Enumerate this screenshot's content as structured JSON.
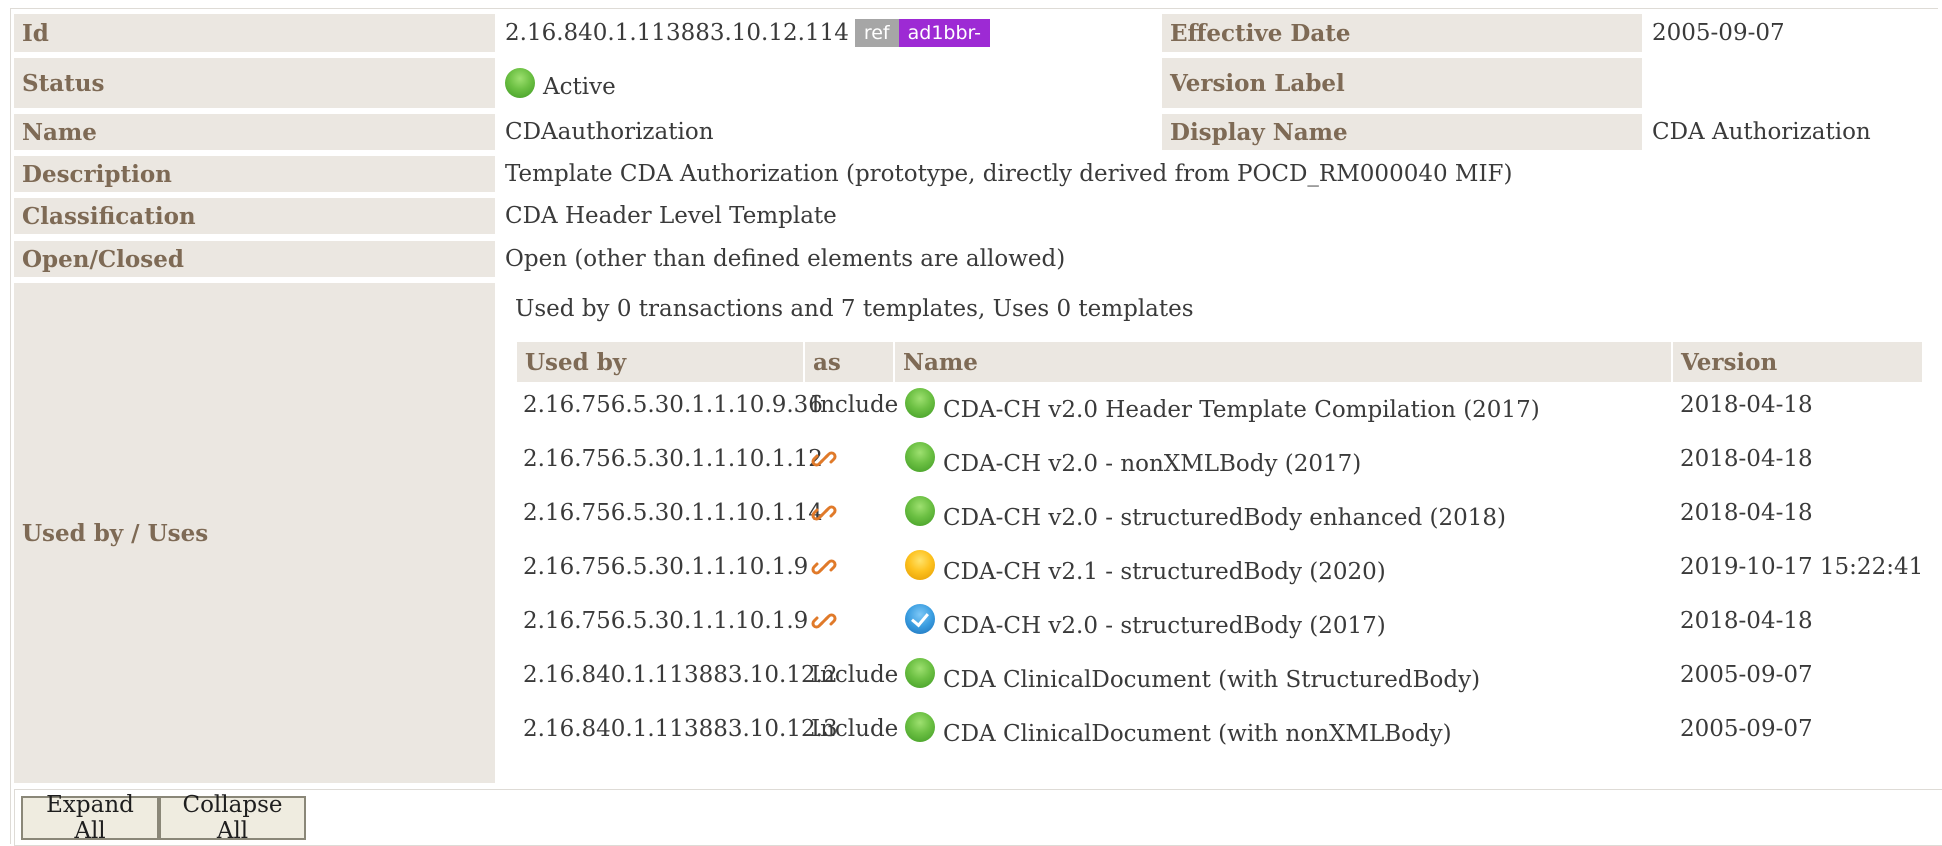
{
  "rows": {
    "id": {
      "label": "Id",
      "value": "2.16.840.1.113883.10.12.114",
      "badge_ref": "ref",
      "badge_prefix": "ad1bbr-"
    },
    "effective_date": {
      "label": "Effective Date",
      "value": "2005-09-07"
    },
    "status": {
      "label": "Status",
      "value": "Active",
      "icon": "status-active-icon"
    },
    "version_label": {
      "label": "Version Label",
      "value": ""
    },
    "name": {
      "label": "Name",
      "value": "CDAauthorization"
    },
    "display_name": {
      "label": "Display Name",
      "value": "CDA Authorization"
    },
    "description": {
      "label": "Description",
      "value": "Template CDA Authorization (prototype, directly derived from POCD_RM000040 MIF)"
    },
    "classification": {
      "label": "Classification",
      "value": "CDA Header Level Template"
    },
    "open_closed": {
      "label": "Open/Closed",
      "value": "Open (other than defined elements are allowed)"
    },
    "used_by_uses": {
      "label": "Used by / Uses"
    }
  },
  "usage": {
    "summary": "Used by 0 transactions and 7 templates, Uses 0 templates",
    "headers": {
      "used_by": "Used by",
      "as": "as",
      "name": "Name",
      "version": "Version"
    },
    "items": [
      {
        "id": "2.16.756.5.30.1.1.10.9.36",
        "as": "Include",
        "status": "green",
        "name": "CDA-CH v2.0 Header Template Compilation (2017)",
        "version": "2018-04-18"
      },
      {
        "id": "2.16.756.5.30.1.1.10.1.12",
        "as": "link-icon",
        "status": "green",
        "name": "CDA-CH v2.0 - nonXMLBody (2017)",
        "version": "2018-04-18"
      },
      {
        "id": "2.16.756.5.30.1.1.10.1.14",
        "as": "link-icon",
        "status": "green",
        "name": "CDA-CH v2.0 - structuredBody enhanced (2018)",
        "version": "2018-04-18"
      },
      {
        "id": "2.16.756.5.30.1.1.10.1.9",
        "as": "link-icon",
        "status": "yellow",
        "name": "CDA-CH v2.1 - structuredBody (2020)",
        "version": "2019-10-17 15:22:41"
      },
      {
        "id": "2.16.756.5.30.1.1.10.1.9",
        "as": "link-icon",
        "status": "blue",
        "name": "CDA-CH v2.0 - structuredBody (2017)",
        "version": "2018-04-18"
      },
      {
        "id": "2.16.840.1.113883.10.12.2",
        "as": "Include",
        "status": "green",
        "name": "CDA ClinicalDocument (with StructuredBody)",
        "version": "2005-09-07"
      },
      {
        "id": "2.16.840.1.113883.10.12.3",
        "as": "Include",
        "status": "green",
        "name": "CDA ClinicalDocument (with nonXMLBody)",
        "version": "2005-09-07"
      }
    ]
  },
  "buttons": {
    "expand_all": "Expand All",
    "collapse_all": "Collapse All"
  },
  "colors": {
    "label_bg": "#ebe7e1",
    "label_text": "#7e6a55",
    "ref_badge": "#a6a6a6",
    "prefix_badge": "#9d2ad4"
  }
}
